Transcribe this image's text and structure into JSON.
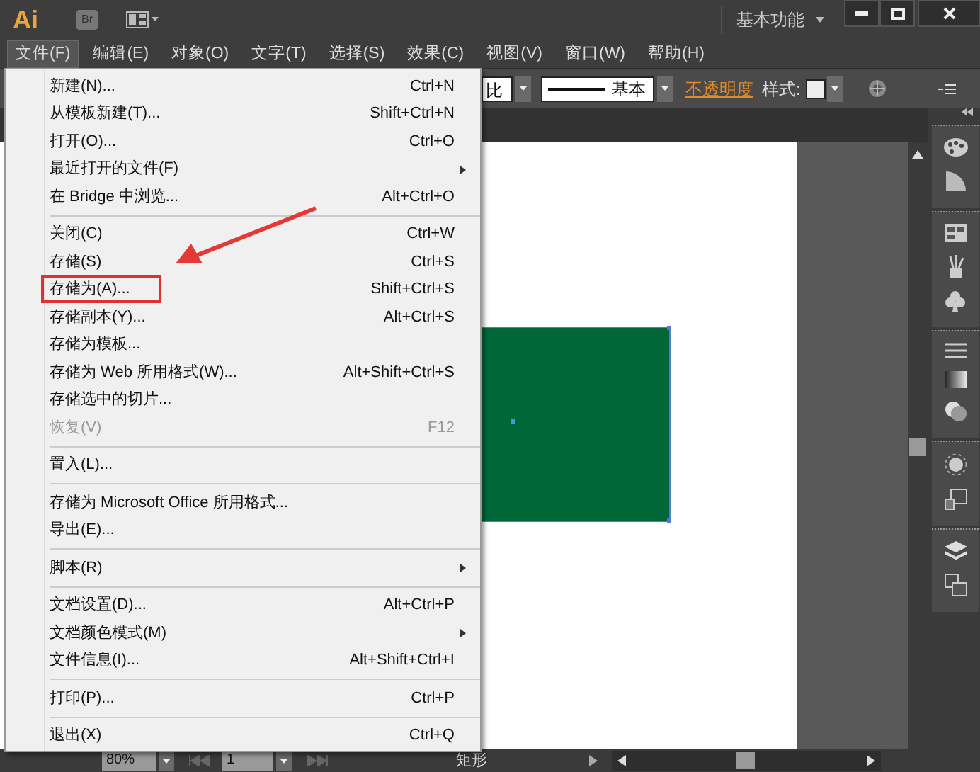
{
  "title_bar": {
    "logo": "Ai",
    "bridge_button": "Br",
    "workspace": "基本功能"
  },
  "menu_bar": [
    {
      "label": "文件(F)",
      "selected": true
    },
    {
      "label": "编辑(E)",
      "selected": false
    },
    {
      "label": "对象(O)",
      "selected": false
    },
    {
      "label": "文字(T)",
      "selected": false
    },
    {
      "label": "选择(S)",
      "selected": false
    },
    {
      "label": "效果(C)",
      "selected": false
    },
    {
      "label": "视图(V)",
      "selected": false
    },
    {
      "label": "窗口(W)",
      "selected": false
    },
    {
      "label": "帮助(H)",
      "selected": false
    }
  ],
  "control_bar": {
    "scale_field": "比",
    "stroke_profile": "基本",
    "opacity_link": "不透明度",
    "style_label": "样式:"
  },
  "file_menu": {
    "items": [
      {
        "kind": "item",
        "label": "新建(N)...",
        "shortcut": "Ctrl+N",
        "submenu": false,
        "disabled": false,
        "highlighted": false
      },
      {
        "kind": "item",
        "label": "从模板新建(T)...",
        "shortcut": "Shift+Ctrl+N",
        "submenu": false,
        "disabled": false,
        "highlighted": false
      },
      {
        "kind": "item",
        "label": "打开(O)...",
        "shortcut": "Ctrl+O",
        "submenu": false,
        "disabled": false,
        "highlighted": false
      },
      {
        "kind": "item",
        "label": "最近打开的文件(F)",
        "submenu": true,
        "disabled": false,
        "highlighted": false
      },
      {
        "kind": "item",
        "label": "在 Bridge 中浏览...",
        "shortcut": "Alt+Ctrl+O",
        "submenu": false,
        "disabled": false,
        "highlighted": false
      },
      {
        "kind": "separator"
      },
      {
        "kind": "item",
        "label": "关闭(C)",
        "shortcut": "Ctrl+W",
        "submenu": false,
        "disabled": false,
        "highlighted": false
      },
      {
        "kind": "item",
        "label": "存储(S)",
        "shortcut": "Ctrl+S",
        "submenu": false,
        "disabled": false,
        "highlighted": false
      },
      {
        "kind": "item",
        "label": "存储为(A)...",
        "shortcut": "Shift+Ctrl+S",
        "submenu": false,
        "disabled": false,
        "highlighted": true
      },
      {
        "kind": "item",
        "label": "存储副本(Y)...",
        "shortcut": "Alt+Ctrl+S",
        "submenu": false,
        "disabled": false,
        "highlighted": false
      },
      {
        "kind": "item",
        "label": "存储为模板...",
        "submenu": false,
        "disabled": false,
        "highlighted": false
      },
      {
        "kind": "item",
        "label": "存储为 Web 所用格式(W)...",
        "shortcut": "Alt+Shift+Ctrl+S",
        "submenu": false,
        "disabled": false,
        "highlighted": false
      },
      {
        "kind": "item",
        "label": "存储选中的切片...",
        "submenu": false,
        "disabled": false,
        "highlighted": false
      },
      {
        "kind": "item",
        "label": "恢复(V)",
        "shortcut": "F12",
        "submenu": false,
        "disabled": true,
        "highlighted": false
      },
      {
        "kind": "separator"
      },
      {
        "kind": "item",
        "label": "置入(L)...",
        "submenu": false,
        "disabled": false,
        "highlighted": false
      },
      {
        "kind": "separator"
      },
      {
        "kind": "item",
        "label": "存储为 Microsoft Office 所用格式...",
        "submenu": false,
        "disabled": false,
        "highlighted": false
      },
      {
        "kind": "item",
        "label": "导出(E)...",
        "submenu": false,
        "disabled": false,
        "highlighted": false
      },
      {
        "kind": "separator"
      },
      {
        "kind": "item",
        "label": "脚本(R)",
        "submenu": true,
        "disabled": false,
        "highlighted": false
      },
      {
        "kind": "separator"
      },
      {
        "kind": "item",
        "label": "文档设置(D)...",
        "shortcut": "Alt+Ctrl+P",
        "submenu": false,
        "disabled": false,
        "highlighted": false
      },
      {
        "kind": "item",
        "label": "文档颜色模式(M)",
        "submenu": true,
        "disabled": false,
        "highlighted": false
      },
      {
        "kind": "item",
        "label": "文件信息(I)...",
        "shortcut": "Alt+Shift+Ctrl+I",
        "submenu": false,
        "disabled": false,
        "highlighted": false
      },
      {
        "kind": "separator"
      },
      {
        "kind": "item",
        "label": "打印(P)...",
        "shortcut": "Ctrl+P",
        "submenu": false,
        "disabled": false,
        "highlighted": false
      },
      {
        "kind": "separator"
      },
      {
        "kind": "item",
        "label": "退出(X)",
        "shortcut": "Ctrl+Q",
        "submenu": false,
        "disabled": false,
        "highlighted": false
      }
    ]
  },
  "status_bar": {
    "zoom": "80%",
    "page": "1",
    "current_tool": "矩形"
  }
}
